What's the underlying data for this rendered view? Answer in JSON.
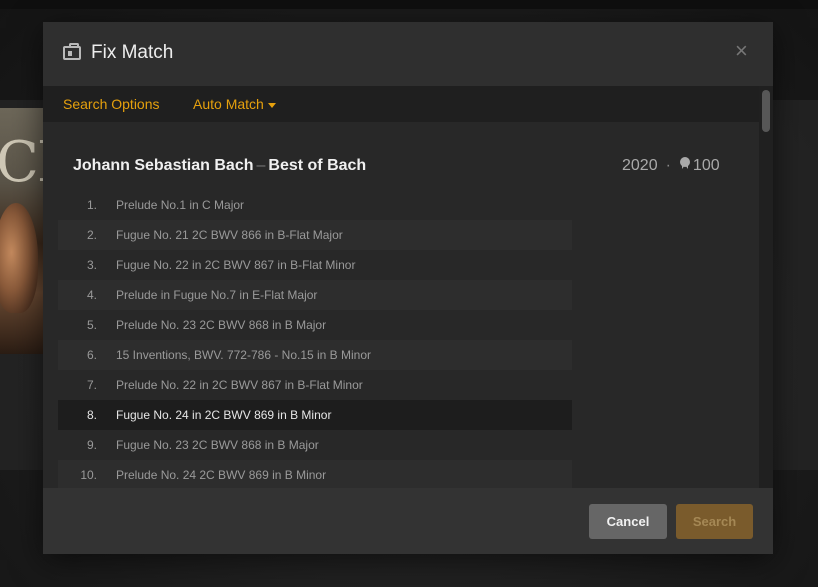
{
  "modal": {
    "title": "Fix Match",
    "close_symbol": "×",
    "icon": "id-card-icon"
  },
  "tabs": {
    "search_options": "Search Options",
    "auto_match": "Auto Match"
  },
  "result": {
    "artist": "Johann Sebastian Bach",
    "separator": "–",
    "album": "Best of Bach",
    "year": "2020",
    "meta_separator": "·",
    "score": "100",
    "score_icon": "award-icon",
    "tracks": [
      {
        "num": "1.",
        "name": "Prelude No.1 in C Major"
      },
      {
        "num": "2.",
        "name": "Fugue No. 21 2C BWV 866 in B-Flat Major"
      },
      {
        "num": "3.",
        "name": "Fugue No. 22 in 2C BWV 867 in B-Flat Minor"
      },
      {
        "num": "4.",
        "name": "Prelude in Fugue No.7 in E-Flat Major"
      },
      {
        "num": "5.",
        "name": "Prelude No. 23 2C BWV 868 in B Major"
      },
      {
        "num": "6.",
        "name": "15 Inventions, BWV. 772-786 - No.15 in B Minor"
      },
      {
        "num": "7.",
        "name": "Prelude No. 22 in 2C BWV 867 in B-Flat Minor"
      },
      {
        "num": "8.",
        "name": "Fugue No. 24 in 2C BWV 869 in B Minor"
      },
      {
        "num": "9.",
        "name": "Fugue No. 23 2C BWV 868 in B Major"
      },
      {
        "num": "10.",
        "name": "Prelude No. 24 2C BWV 869 in B Minor"
      }
    ]
  },
  "footer": {
    "cancel_label": "Cancel",
    "search_label": "Search"
  },
  "background": {
    "poster_text": "CH"
  },
  "colors": {
    "accent": "#e5a00d",
    "modal_bg": "#282828"
  }
}
